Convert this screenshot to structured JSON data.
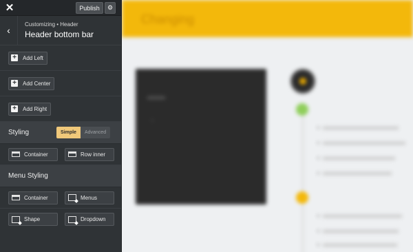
{
  "topbar": {
    "close_glyph": "✕",
    "publish_label": "Publish",
    "gear_glyph": "⚙"
  },
  "section": {
    "back_glyph": "‹",
    "breadcrumb": "Customizing • Header",
    "title": "Header bottom bar"
  },
  "add_buttons": [
    {
      "label": "Add Left"
    },
    {
      "label": "Add Center"
    },
    {
      "label": "Add Right"
    }
  ],
  "styling": {
    "label": "Styling",
    "mode_options": [
      "Simple",
      "Advanced"
    ],
    "selected_mode": "Simple",
    "buttons": [
      {
        "label": "Container"
      },
      {
        "label": "Row inner"
      }
    ]
  },
  "menu_styling": {
    "label": "Menu Styling",
    "buttons": [
      {
        "label": "Container"
      },
      {
        "label": "Menus"
      },
      {
        "label": "Shape"
      },
      {
        "label": "Dropdown"
      }
    ]
  },
  "preview": {
    "brand": "Changing"
  },
  "colors": {
    "accent": "#f3b80b",
    "sidebar_bg": "#2f3336",
    "toggle_active": "#f0c87a"
  }
}
